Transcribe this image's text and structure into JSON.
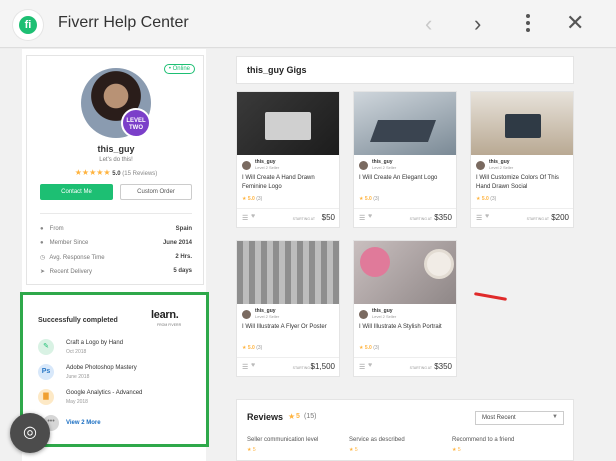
{
  "app": {
    "logo_letter": "fi",
    "title": "Fiverr Help Center"
  },
  "nav": {
    "back": "‹",
    "forward": "›",
    "close": "✕"
  },
  "profile": {
    "online_label": "• Online",
    "level_line1": "LEVEL",
    "level_line2": "TWO",
    "username": "this_guy",
    "tagline": "Let's do this!",
    "stars": "★★★★★",
    "rating": "5.0",
    "review_count": "(15 Reviews)",
    "contact_label": "Contact Me",
    "custom_order_label": "Custom Order",
    "stats": [
      {
        "icon": "location-pin-icon",
        "glyph": "●",
        "label": "From",
        "value": "Spain"
      },
      {
        "icon": "user-icon",
        "glyph": "●",
        "label": "Member Since",
        "value": "June 2014"
      },
      {
        "icon": "clock-icon",
        "glyph": "◷",
        "label": "Avg. Response Time",
        "value": "2 Hrs."
      },
      {
        "icon": "send-icon",
        "glyph": "➤",
        "label": "Recent Delivery",
        "value": "5 days"
      }
    ]
  },
  "learn": {
    "title": "Successfully completed",
    "logo": "learn.",
    "logo_sub": "FROM FIVERR",
    "courses": [
      {
        "icon": "pen-icon",
        "glyph": "✎",
        "color": "#d9f2e4",
        "name": "Craft a Logo by Hand",
        "date": "Oct 2018"
      },
      {
        "icon": "photoshop-icon",
        "glyph": "Ps",
        "color": "#d8e8fa",
        "name": "Adobe Photoshop Mastery",
        "date": "June 2018"
      },
      {
        "icon": "analytics-icon",
        "glyph": "▇",
        "color": "#fde9c6",
        "name": "Google Analytics - Advanced",
        "date": "May 2018"
      }
    ],
    "more_glyph": "•••",
    "view_more": "View 2 More"
  },
  "gigs": {
    "header": "this_guy Gigs",
    "items": [
      {
        "seller": "this_guy",
        "level": "Level 2 Seller",
        "title": "I Will Create A Hand Drawn Feminine Logo",
        "rating": "5.0",
        "count": "(3)",
        "starting": "STARTING AT",
        "price": "$50"
      },
      {
        "seller": "this_guy",
        "level": "Level 2 Seller",
        "title": "I Will Create An Elegant Logo",
        "rating": "5.0",
        "count": "(3)",
        "starting": "STARTING AT",
        "price": "$350"
      },
      {
        "seller": "this_guy",
        "level": "Level 2 Seller",
        "title": "I Will Customize Colors Of This Hand Drawn Social",
        "rating": "5.0",
        "count": "(3)",
        "starting": "STARTING AT",
        "price": "$200"
      },
      {
        "seller": "this_guy",
        "level": "Level 2 Seller",
        "title": "I Will Illustrate A Flyer Or Poster",
        "rating": "5.0",
        "count": "(3)",
        "starting": "STARTING AT",
        "price": "$1,500"
      },
      {
        "seller": "this_guy",
        "level": "Level 2 Seller",
        "title": "I Will Illustrate A Stylish Portrait",
        "rating": "5.0",
        "count": "(3)",
        "starting": "STARTING AT",
        "price": "$350"
      }
    ]
  },
  "reviews": {
    "title": "Reviews",
    "score": "5",
    "count": "(15)",
    "sort": "Most Recent",
    "columns": [
      {
        "label": "Seller communication level",
        "value": "★ 5"
      },
      {
        "label": "Service as described",
        "value": "★ 5"
      },
      {
        "label": "Recommend to a friend",
        "value": "★ 5"
      }
    ]
  },
  "colors": {
    "brand_green": "#1dbf73",
    "star": "#ffb33e",
    "highlight_box": "#2ea84a",
    "annotation_red": "#e02a2a"
  }
}
